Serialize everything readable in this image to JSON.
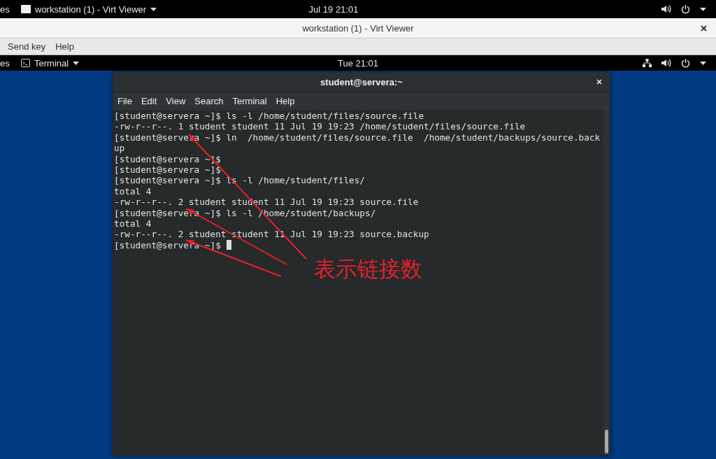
{
  "host_top_bar": {
    "activities": "es",
    "app_menu": "workstation (1) - Virt Viewer",
    "clock": "Jul 19  21:01"
  },
  "viewer_window": {
    "title": "workstation (1) - Virt Viewer",
    "menu": [
      "Send key",
      "Help"
    ]
  },
  "guest_top_bar": {
    "activities": "es",
    "app_menu": "Terminal",
    "clock": "Tue 21:01"
  },
  "terminal": {
    "title": "student@servera:~",
    "menu": [
      "File",
      "Edit",
      "View",
      "Search",
      "Terminal",
      "Help"
    ],
    "lines": [
      "[student@servera ~]$ ls -l /home/student/files/source.file",
      "-rw-r--r--. 1 student student 11 Jul 19 19:23 /home/student/files/source.file",
      "[student@servera ~]$ ln  /home/student/files/source.file  /home/student/backups/source.back",
      "up",
      "[student@servera ~]$",
      "[student@servera ~]$",
      "[student@servera ~]$ ls -l /home/student/files/",
      "total 4",
      "-rw-r--r--. 2 student student 11 Jul 19 19:23 source.file",
      "[student@servera ~]$ ls -l /home/student/backups/",
      "total 4",
      "-rw-r--r--. 2 student student 11 Jul 19 19:23 source.backup",
      "[student@servera ~]$"
    ]
  },
  "annotation": {
    "text": "表示链接数"
  }
}
